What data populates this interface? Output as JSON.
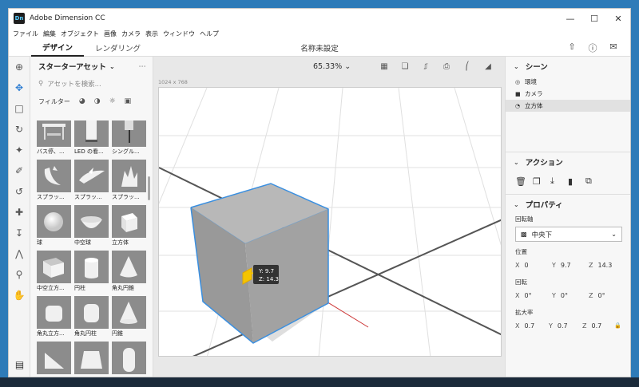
{
  "window": {
    "title": "Adobe Dimension CC",
    "app_icon": "Dn"
  },
  "menu": [
    "ファイル",
    "編集",
    "オブジェクト",
    "画像",
    "カメラ",
    "表示",
    "ウィンドウ",
    "ヘルプ"
  ],
  "tabs": [
    {
      "label": "デザイン",
      "active": true
    },
    {
      "label": "レンダリング",
      "active": false
    }
  ],
  "doc_title": "名称未設定",
  "assets": {
    "title": "スターターアセット",
    "search_placeholder": "アセットを検索...",
    "filter_label": "フィルター",
    "items": [
      {
        "label": "バス停、..."
      },
      {
        "label": "LED の看..."
      },
      {
        "label": "シングル..."
      },
      {
        "label": "スプラッ..."
      },
      {
        "label": "スプラッ..."
      },
      {
        "label": "スプラッ..."
      },
      {
        "label": "球"
      },
      {
        "label": "中空球"
      },
      {
        "label": "立方体"
      },
      {
        "label": "中空立方..."
      },
      {
        "label": "円柱"
      },
      {
        "label": "角丸円錐"
      },
      {
        "label": "角丸立方..."
      },
      {
        "label": "角丸円柱"
      },
      {
        "label": "円錐"
      },
      {
        "label": ""
      },
      {
        "label": ""
      },
      {
        "label": ""
      }
    ]
  },
  "viewport": {
    "zoom": "65.33%",
    "canvas_size": "1024 x 768",
    "gizmo_y": "Y: 9.7",
    "gizmo_z": "Z: 14.3"
  },
  "scene": {
    "title": "シーン",
    "items": [
      {
        "label": "環境",
        "icon": "globe-icon",
        "selected": false
      },
      {
        "label": "カメラ",
        "icon": "camera-icon",
        "selected": false
      },
      {
        "label": "立方体",
        "icon": "cube-icon",
        "selected": true
      }
    ]
  },
  "actions": {
    "title": "アクション"
  },
  "properties": {
    "title": "プロパティ",
    "pivot_label": "回転軸",
    "pivot_value": "中央下",
    "position_label": "位置",
    "position": {
      "x": "0",
      "y": "9.7",
      "z": "14.3"
    },
    "rotation_label": "回転",
    "rotation": {
      "x": "0°",
      "y": "0°",
      "z": "0°"
    },
    "scale_label": "拡大率",
    "scale": {
      "x": "0.7",
      "y": "0.7",
      "z": "0.7"
    }
  },
  "colors": {
    "selection": "#3a8fe0",
    "accent": "#2d7dd2",
    "gizmo": "#f5c400"
  }
}
